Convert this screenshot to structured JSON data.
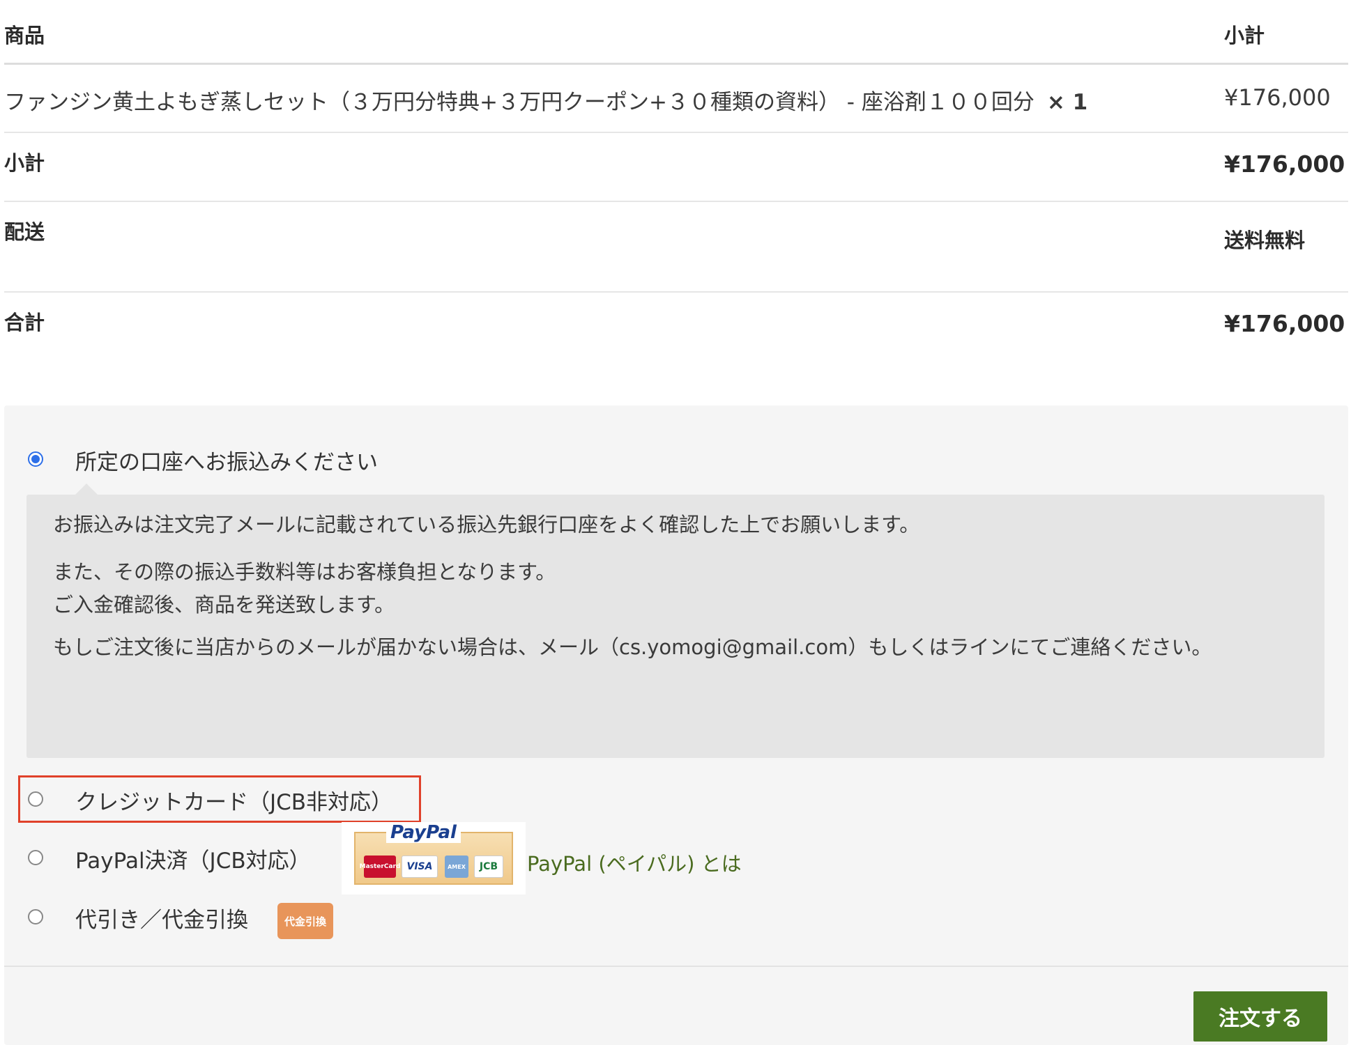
{
  "order_table": {
    "header": {
      "product": "商品",
      "subtotal": "小計"
    },
    "item": {
      "name": "ファンジン黄土よもぎ蒸しセット（３万円分特典+３万円クーポン+３０種類の資料） - 座浴剤１００回分",
      "qty": "× 1",
      "price": "¥176,000"
    },
    "subtotal": {
      "label": "小計",
      "value": "¥176,000"
    },
    "shipping": {
      "label": "配送",
      "value": "送料無料"
    },
    "total": {
      "label": "合計",
      "value": "¥176,000"
    }
  },
  "payment": {
    "methods": [
      {
        "label": "所定の口座へお振込みください",
        "checked": true
      },
      {
        "label": "クレジットカード（JCB非対応）",
        "checked": false
      },
      {
        "label": "PayPal決済（JCB対応）",
        "checked": false
      },
      {
        "label": "代引き／代金引換",
        "checked": false
      }
    ],
    "bank_description": {
      "p1": "お振込みは注文完了メールに記載されている振込先銀行口座をよく確認した上でお願いします。",
      "p2_line1": "また、その際の振込手数料等はお客様負担となります。",
      "p2_line2": "ご入金確認後、商品を発送致します。",
      "p3": "もしご注文後に当店からのメールが届かない場合は、メール（cs.yomogi@gmail.com）もしくはラインにてご連絡ください。"
    },
    "paypal_logo": {
      "title": "PayPal",
      "cards": {
        "mastercard": "MasterCard",
        "visa": "VISA",
        "amex": "AMEX",
        "jcb": "JCB"
      }
    },
    "paypal_link": "PayPal (ペイパル) とは",
    "cod_badge": "代金引換",
    "highlight_color": "#e0412a"
  },
  "order_button": {
    "label": "注文する",
    "color": "#4a7a23"
  }
}
